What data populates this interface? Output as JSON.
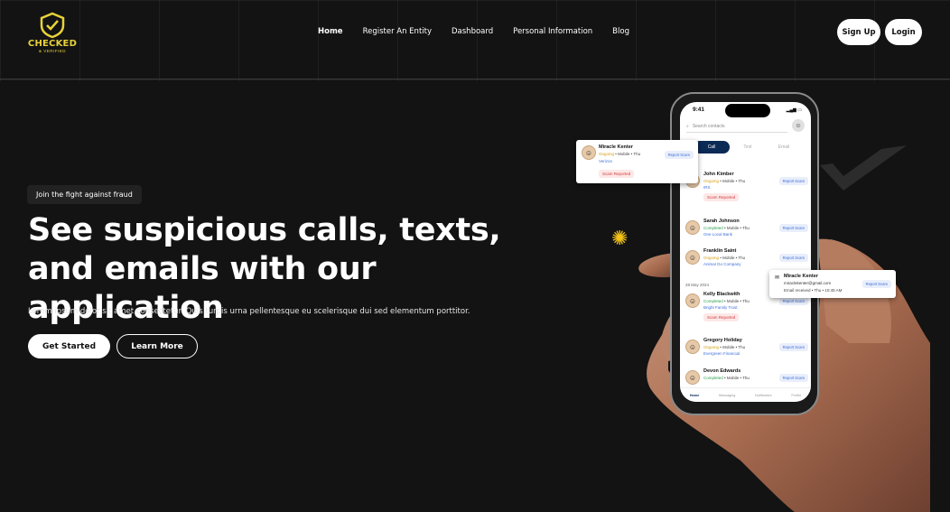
{
  "brand": {
    "name": "CHECKED",
    "sub": "& VERIFIED",
    "color": "#e8d23a"
  },
  "nav": {
    "items": [
      "Home",
      "Register An Entity",
      "Dashboard",
      "Personal Information",
      "Blog"
    ],
    "active": "Home"
  },
  "header": {
    "signup_label": "Sign Up",
    "login_label": "Login"
  },
  "hero": {
    "tagline": "Join the fight against fraud",
    "title_line1": "See suspicious calls, texts,",
    "title_line2": "and emails with our application",
    "subtitle": "Lorem ipsum dolor sit amet consectetur. Quis turpis urna pellentesque eu scelerisque dui sed elementum porttitor.",
    "cta_primary": "Get Started",
    "cta_secondary": "Learn More"
  },
  "phone": {
    "time": "9:41",
    "search_placeholder": "Search contacts",
    "tabs": [
      "Call",
      "Text",
      "Email"
    ],
    "active_tab": "Call",
    "date_separator": "28 May 2024",
    "contacts": [
      {
        "name": "John Kimber",
        "status": "Ongoing",
        "meta": "• Mobile • Thu",
        "org": "IRS",
        "button": "Report Scam",
        "reported": "Scam Reported"
      },
      {
        "name": "Sarah Johnson",
        "status": "Completed",
        "meta": "• Mobile • Thu",
        "org": "One Local Bank",
        "button": "Report Scam"
      },
      {
        "name": "Franklin Saint",
        "status": "Ongoing",
        "meta": "• Mobile • Thu",
        "org": "Animal Go Company",
        "button": "Report Scam"
      },
      {
        "name": "Kelly Blackwith",
        "status": "Completed",
        "meta": "• Mobile • Thu",
        "org": "Bright Family Trust",
        "button": "Report Scam",
        "reported": "Scam Reported"
      },
      {
        "name": "Gregory Holiday",
        "status": "Ongoing",
        "meta": "• Mobile • Thu",
        "org": "Evergreen Financial",
        "button": "Report Scam"
      },
      {
        "name": "Devon Edwards",
        "status": "Completed",
        "meta": "• Mobile • Thu",
        "org": "",
        "button": "Report Scam"
      }
    ],
    "bottom_nav": [
      "Home",
      "Messaging",
      "Notification",
      "Profile"
    ]
  },
  "float_card_1": {
    "name": "Miracle Kenter",
    "status": "Ongoing",
    "meta": "• Mobile • Thu",
    "org": "Verizon",
    "button": "Report Scam",
    "reported": "Scam Reported"
  },
  "float_card_2": {
    "name": "Miracle Kenter",
    "email": "miraclekenter@gmail.com",
    "meta": "Email received • Thu • 10:45 AM",
    "button": "Report Scam"
  }
}
